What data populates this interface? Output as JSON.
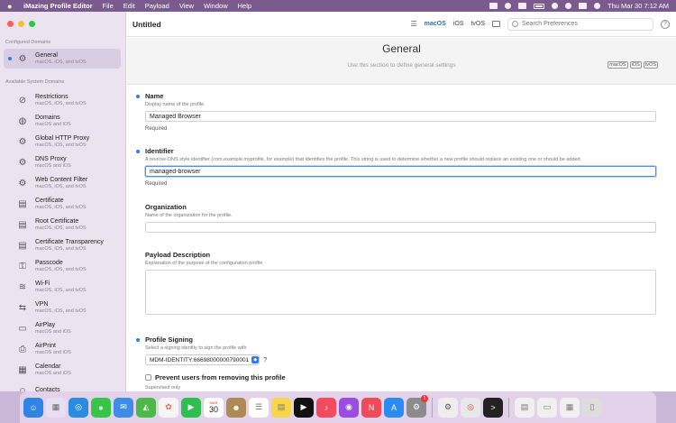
{
  "menubar": {
    "app": "iMazing Profile Editor",
    "menus": [
      "File",
      "Edit",
      "Payload",
      "View",
      "Window",
      "Help"
    ],
    "clock": "Thu Mar 30  7:12 AM"
  },
  "window": {
    "title": "Untitled"
  },
  "toolbar": {
    "platforms": [
      "macOS",
      "iOS",
      "tvOS"
    ],
    "active_platform": "macOS",
    "search_placeholder": "Search Preferences"
  },
  "sidebar": {
    "configured_label": "Configured Domains",
    "configured": [
      {
        "title": "General",
        "sub": "macOS, iOS, and tvOS",
        "icon": "gear-icon"
      }
    ],
    "system_label": "Available System Domains",
    "items": [
      {
        "title": "Restrictions",
        "sub": "macOS, iOS, and tvOS",
        "icon": "restrictions-icon",
        "glyph": "⊘"
      },
      {
        "title": "Domains",
        "sub": "macOS and iOS",
        "icon": "globe-icon",
        "glyph": "◍"
      },
      {
        "title": "Global HTTP Proxy",
        "sub": "macOS, iOS, and tvOS",
        "icon": "proxy-icon",
        "glyph": "⚙"
      },
      {
        "title": "DNS Proxy",
        "sub": "macOS and iOS",
        "icon": "dns-proxy-icon",
        "glyph": "⚙"
      },
      {
        "title": "Web Content Filter",
        "sub": "macOS, iOS, and tvOS",
        "icon": "filter-icon",
        "glyph": "⚙"
      },
      {
        "title": "Certificate",
        "sub": "macOS, iOS, and tvOS",
        "icon": "certificate-icon",
        "glyph": "▤"
      },
      {
        "title": "Root Certificate",
        "sub": "macOS, iOS, and tvOS",
        "icon": "root-certificate-icon",
        "glyph": "▤"
      },
      {
        "title": "Certificate Transparency",
        "sub": "macOS, iOS, and tvOS",
        "icon": "transparency-icon",
        "glyph": "▤"
      },
      {
        "title": "Passcode",
        "sub": "macOS, iOS, and tvOS",
        "icon": "passcode-icon",
        "glyph": "⚿"
      },
      {
        "title": "Wi-Fi",
        "sub": "macOS, iOS, and tvOS",
        "icon": "wifi-icon",
        "glyph": "≋"
      },
      {
        "title": "VPN",
        "sub": "macOS, iOS, and tvOS",
        "icon": "vpn-icon",
        "glyph": "⇆"
      },
      {
        "title": "AirPlay",
        "sub": "macOS and iOS",
        "icon": "airplay-icon",
        "glyph": "▭"
      },
      {
        "title": "AirPrint",
        "sub": "macOS and iOS",
        "icon": "airprint-icon",
        "glyph": "⎙"
      },
      {
        "title": "Calendar",
        "sub": "macOS and iOS",
        "icon": "calendar-icon",
        "glyph": "▦"
      },
      {
        "title": "Contacts",
        "sub": "",
        "icon": "contacts-icon",
        "glyph": "☺"
      }
    ]
  },
  "main": {
    "title": "General",
    "subtitle": "Use this section to define general settings",
    "badges": [
      "macOS",
      "iOS",
      "tvOS"
    ],
    "name": {
      "label": "Name",
      "desc": "Display name of the profile.",
      "value": "Managed Browser",
      "required": "Required"
    },
    "identifier": {
      "label": "Identifier",
      "desc": "A reverse-DNS style identifier (com.example.myprofile, for example) that identifies the profile. This string is used to determine whether a new profile should replace an existing one or should be added.",
      "value": "managed-browser",
      "required": "Required"
    },
    "organization": {
      "label": "Organization",
      "desc": "Name of the organization for the profile."
    },
    "payload_desc": {
      "label": "Payload Description",
      "desc": "Explanation of the purpose of the configuration profile"
    },
    "signing": {
      "label": "Profile Signing",
      "desc": "Select a signing identity to sign the profile with",
      "value": "MDM-IDENTITY:66698000000790001",
      "help": "?"
    },
    "prevent": {
      "label": "Prevent users from removing this profile",
      "sub": "Supervised only"
    }
  },
  "dock": {
    "calendar_month": "MAR",
    "calendar_day": "30",
    "badge": "1"
  }
}
